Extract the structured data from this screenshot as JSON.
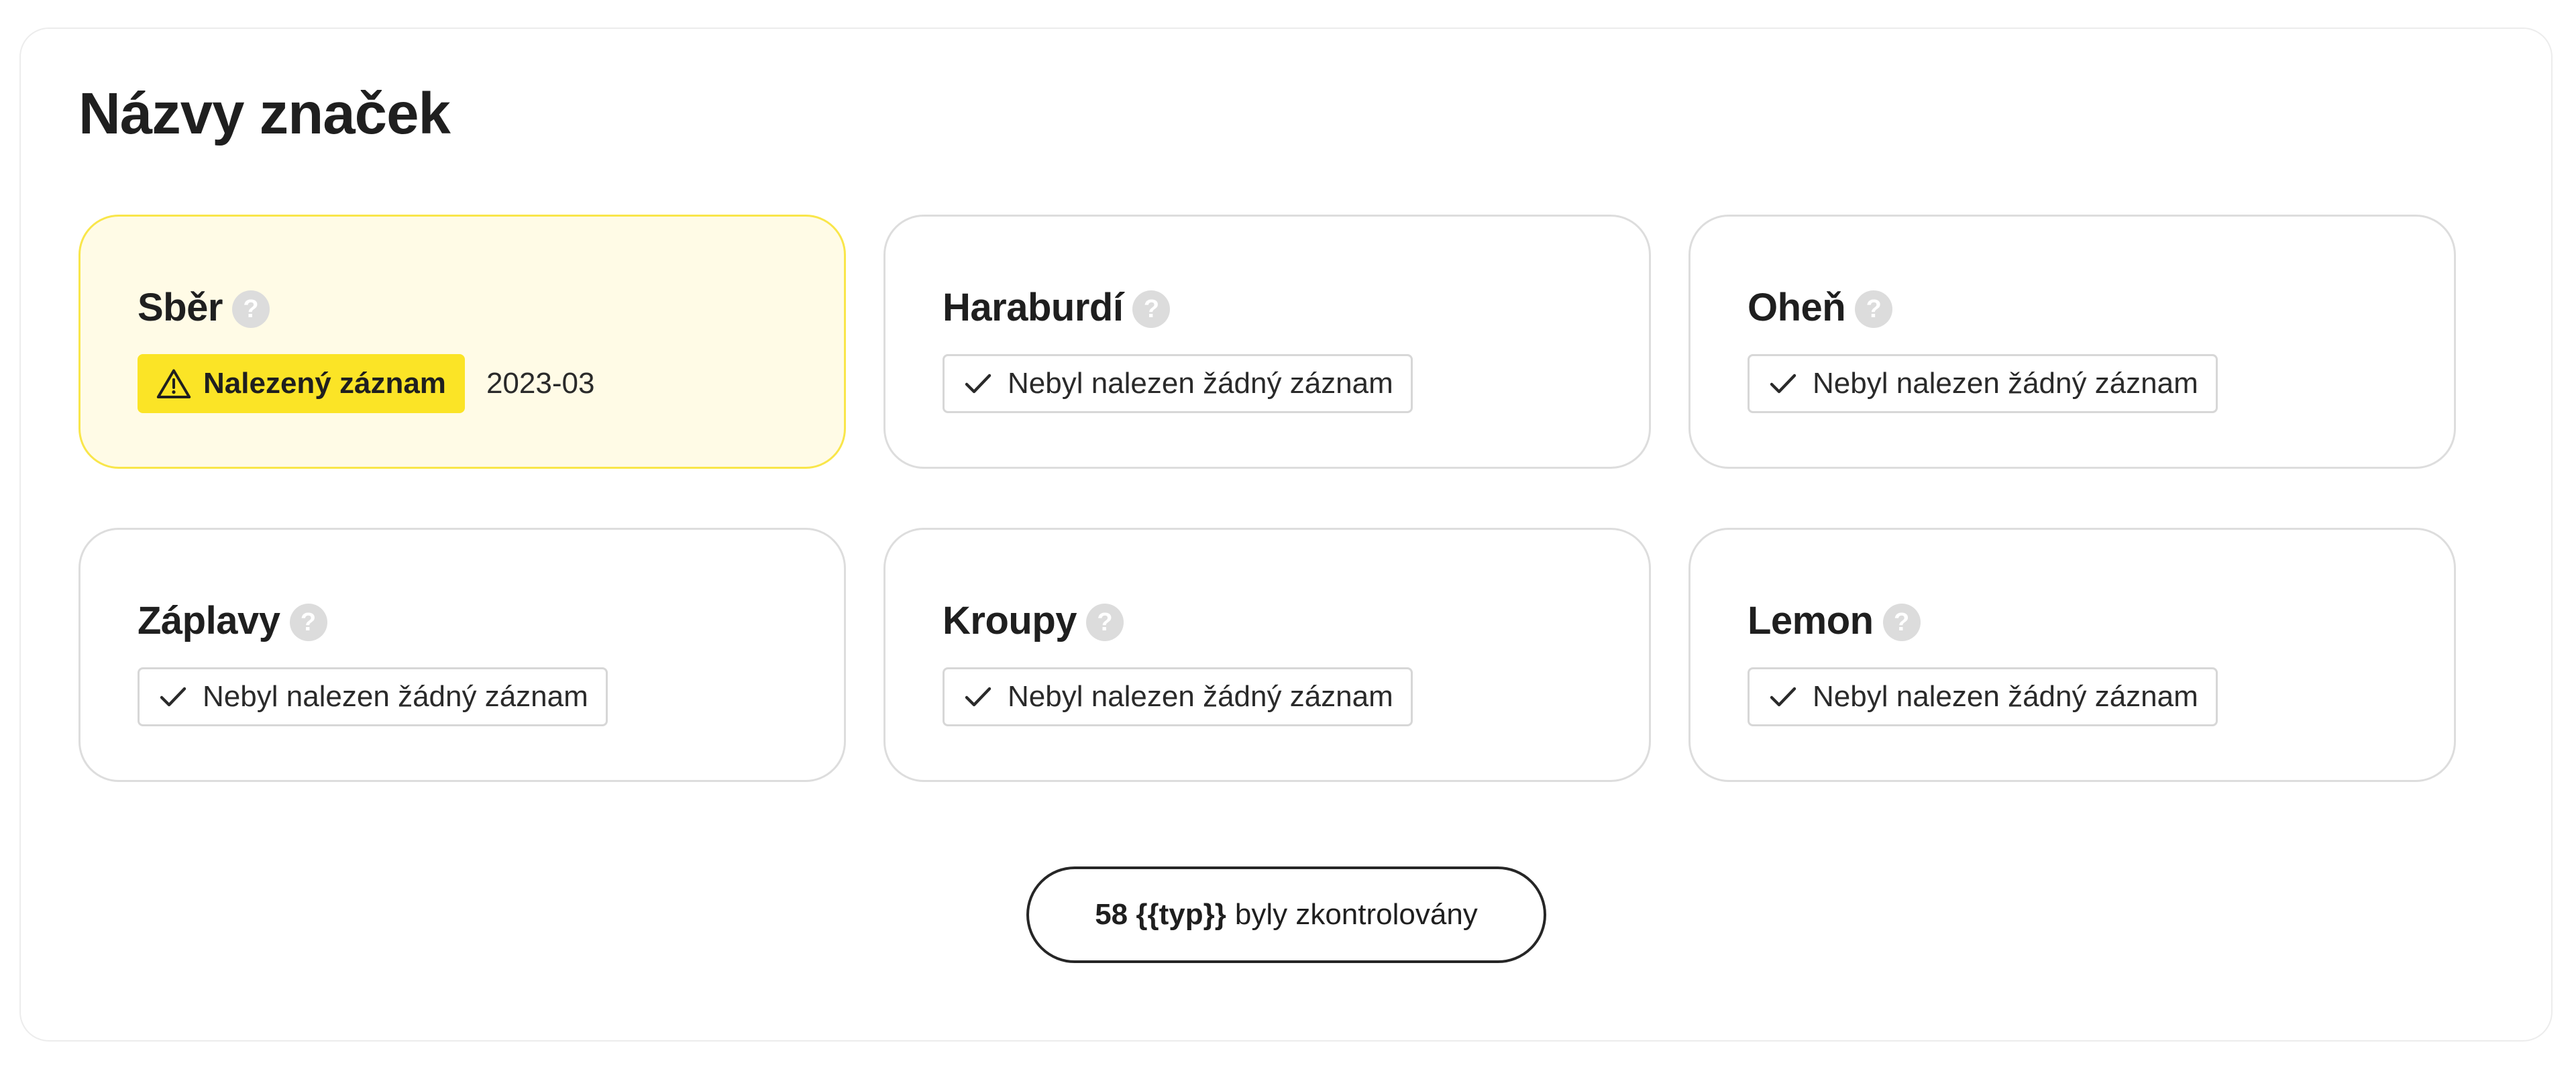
{
  "section": {
    "title": "Názvy značek"
  },
  "cards": [
    {
      "title": "Sběr",
      "help_glyph": "?",
      "status": "found",
      "badge_label": "Nalezený záznam",
      "date": "2023-03",
      "icon": "warning-triangle-icon"
    },
    {
      "title": "Haraburdí",
      "help_glyph": "?",
      "status": "ok",
      "badge_label": "Nebyl nalezen žádný záznam",
      "icon": "check-icon"
    },
    {
      "title": "Oheň",
      "help_glyph": "?",
      "status": "ok",
      "badge_label": "Nebyl nalezen žádný záznam",
      "icon": "check-icon"
    },
    {
      "title": "Záplavy",
      "help_glyph": "?",
      "status": "ok",
      "badge_label": "Nebyl nalezen žádný záznam",
      "icon": "check-icon"
    },
    {
      "title": "Kroupy",
      "help_glyph": "?",
      "status": "ok",
      "badge_label": "Nebyl nalezen žádný záznam",
      "icon": "check-icon"
    },
    {
      "title": "Lemon",
      "help_glyph": "?",
      "status": "ok",
      "badge_label": "Nebyl nalezen žádný záznam",
      "icon": "check-icon"
    }
  ],
  "summary": {
    "count_label": "58 {{typ}}",
    "suffix": "byly zkontrolovány"
  },
  "colors": {
    "found_background": "#fffbe6",
    "found_border": "#f9e64a",
    "found_badge": "#fbe426",
    "card_border": "#dddddd",
    "help_icon": "#dcdcdc"
  }
}
